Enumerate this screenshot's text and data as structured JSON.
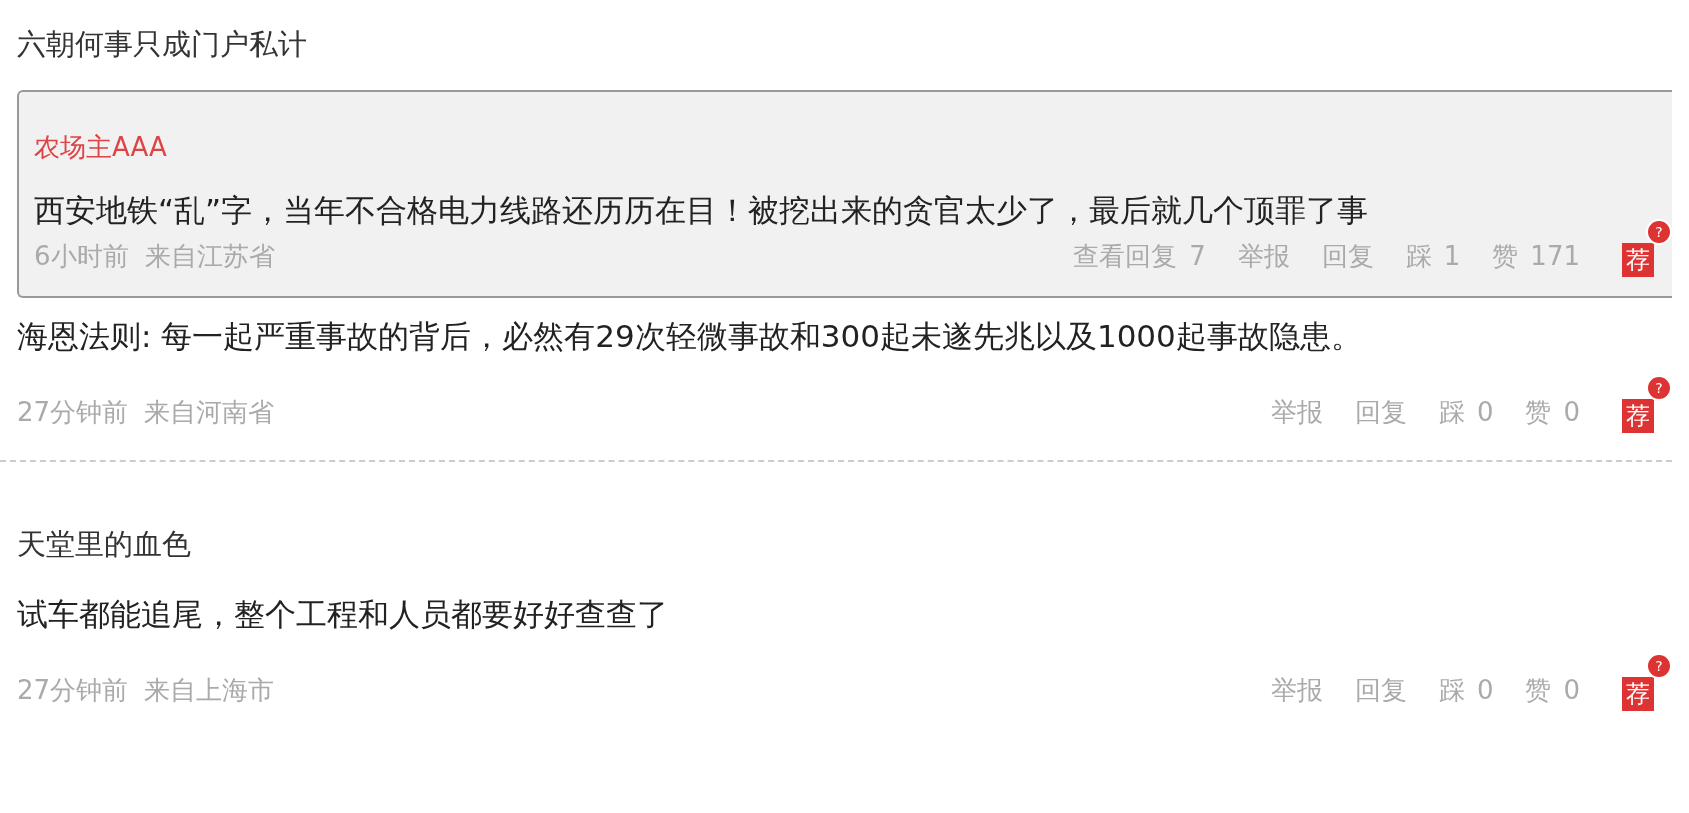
{
  "comments": [
    {
      "user": "六朝何事只成门户私计",
      "quote": {
        "author": "农场主AAA",
        "text": "西安地铁“乱”字，当年不合格电力线路还历历在目！被挖出来的贪官太少了，最后就几个顶罪了事",
        "time": "6小时前",
        "location": "来自江苏省",
        "actions": [
          {
            "label": "查看回复",
            "count": "7"
          },
          {
            "label": "举报"
          },
          {
            "label": "回复"
          },
          {
            "label": "踩",
            "count": "1"
          },
          {
            "label": "赞",
            "count": "171"
          }
        ],
        "badge": {
          "label": "荐",
          "help": "?"
        }
      },
      "text": "海恩法则: 每一起严重事故的背后，必然有29次轻微事故和300起未遂先兆以及1000起事故隐患。",
      "time": "27分钟前",
      "location": "来自河南省",
      "actions": [
        {
          "label": "举报"
        },
        {
          "label": "回复"
        },
        {
          "label": "踩",
          "count": "0"
        },
        {
          "label": "赞",
          "count": "0"
        }
      ],
      "badge": {
        "label": "荐",
        "help": "?"
      }
    },
    {
      "user": "天堂里的血色",
      "text": "试车都能追尾，整个工程和人员都要好好查查了",
      "time": "27分钟前",
      "location": "来自上海市",
      "actions": [
        {
          "label": "举报"
        },
        {
          "label": "回复"
        },
        {
          "label": "踩",
          "count": "0"
        },
        {
          "label": "赞",
          "count": "0"
        }
      ],
      "badge": {
        "label": "荐",
        "help": "?"
      }
    }
  ]
}
